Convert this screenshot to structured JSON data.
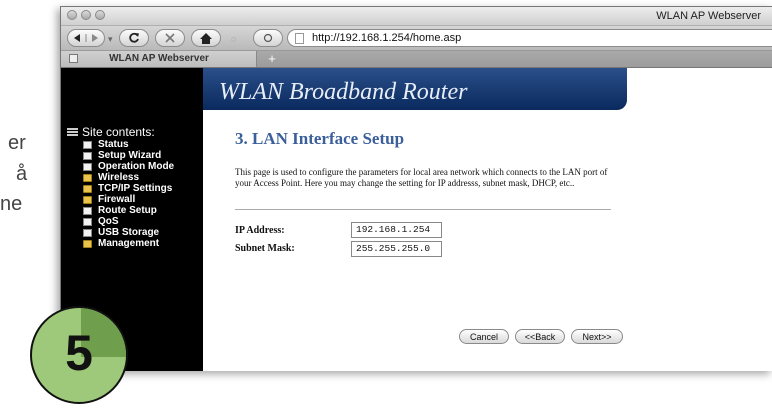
{
  "background_text": [
    "er",
    "å",
    "ne"
  ],
  "window": {
    "title": "WLAN AP Webserver"
  },
  "toolbar": {
    "url": "http://192.168.1.254/home.asp"
  },
  "tabs": [
    {
      "label": "WLAN AP Webserver"
    }
  ],
  "newtab_label": "+",
  "router": {
    "banner_title": "WLAN Broadband Router"
  },
  "sidebar": {
    "heading": "Site contents:",
    "items": [
      {
        "label": "Status",
        "icon": "doc"
      },
      {
        "label": "Setup Wizard",
        "icon": "doc"
      },
      {
        "label": "Operation Mode",
        "icon": "doc"
      },
      {
        "label": "Wireless",
        "icon": "folder"
      },
      {
        "label": "TCP/IP Settings",
        "icon": "folder"
      },
      {
        "label": "Firewall",
        "icon": "folder"
      },
      {
        "label": "Route Setup",
        "icon": "doc"
      },
      {
        "label": "QoS",
        "icon": "doc"
      },
      {
        "label": "USB Storage",
        "icon": "doc"
      },
      {
        "label": "Management",
        "icon": "folder"
      }
    ]
  },
  "page": {
    "title": "3. LAN Interface Setup",
    "description": "This page is used to configure the parameters for local area network which connects to the LAN port of your Access Point. Here you may change the setting for IP addresss, subnet mask, DHCP, etc..",
    "ip_label": "IP Address:",
    "ip_value": "192.168.1.254",
    "mask_label": "Subnet Mask:",
    "mask_value": "255.255.255.0",
    "buttons": {
      "cancel": "Cancel",
      "back": "<<Back",
      "next": "Next>>"
    }
  },
  "badge": {
    "number": "5"
  },
  "colors": {
    "banner": "#1e427c",
    "title_blue": "#3a5f9a",
    "badge_green": "#9fc97a"
  }
}
